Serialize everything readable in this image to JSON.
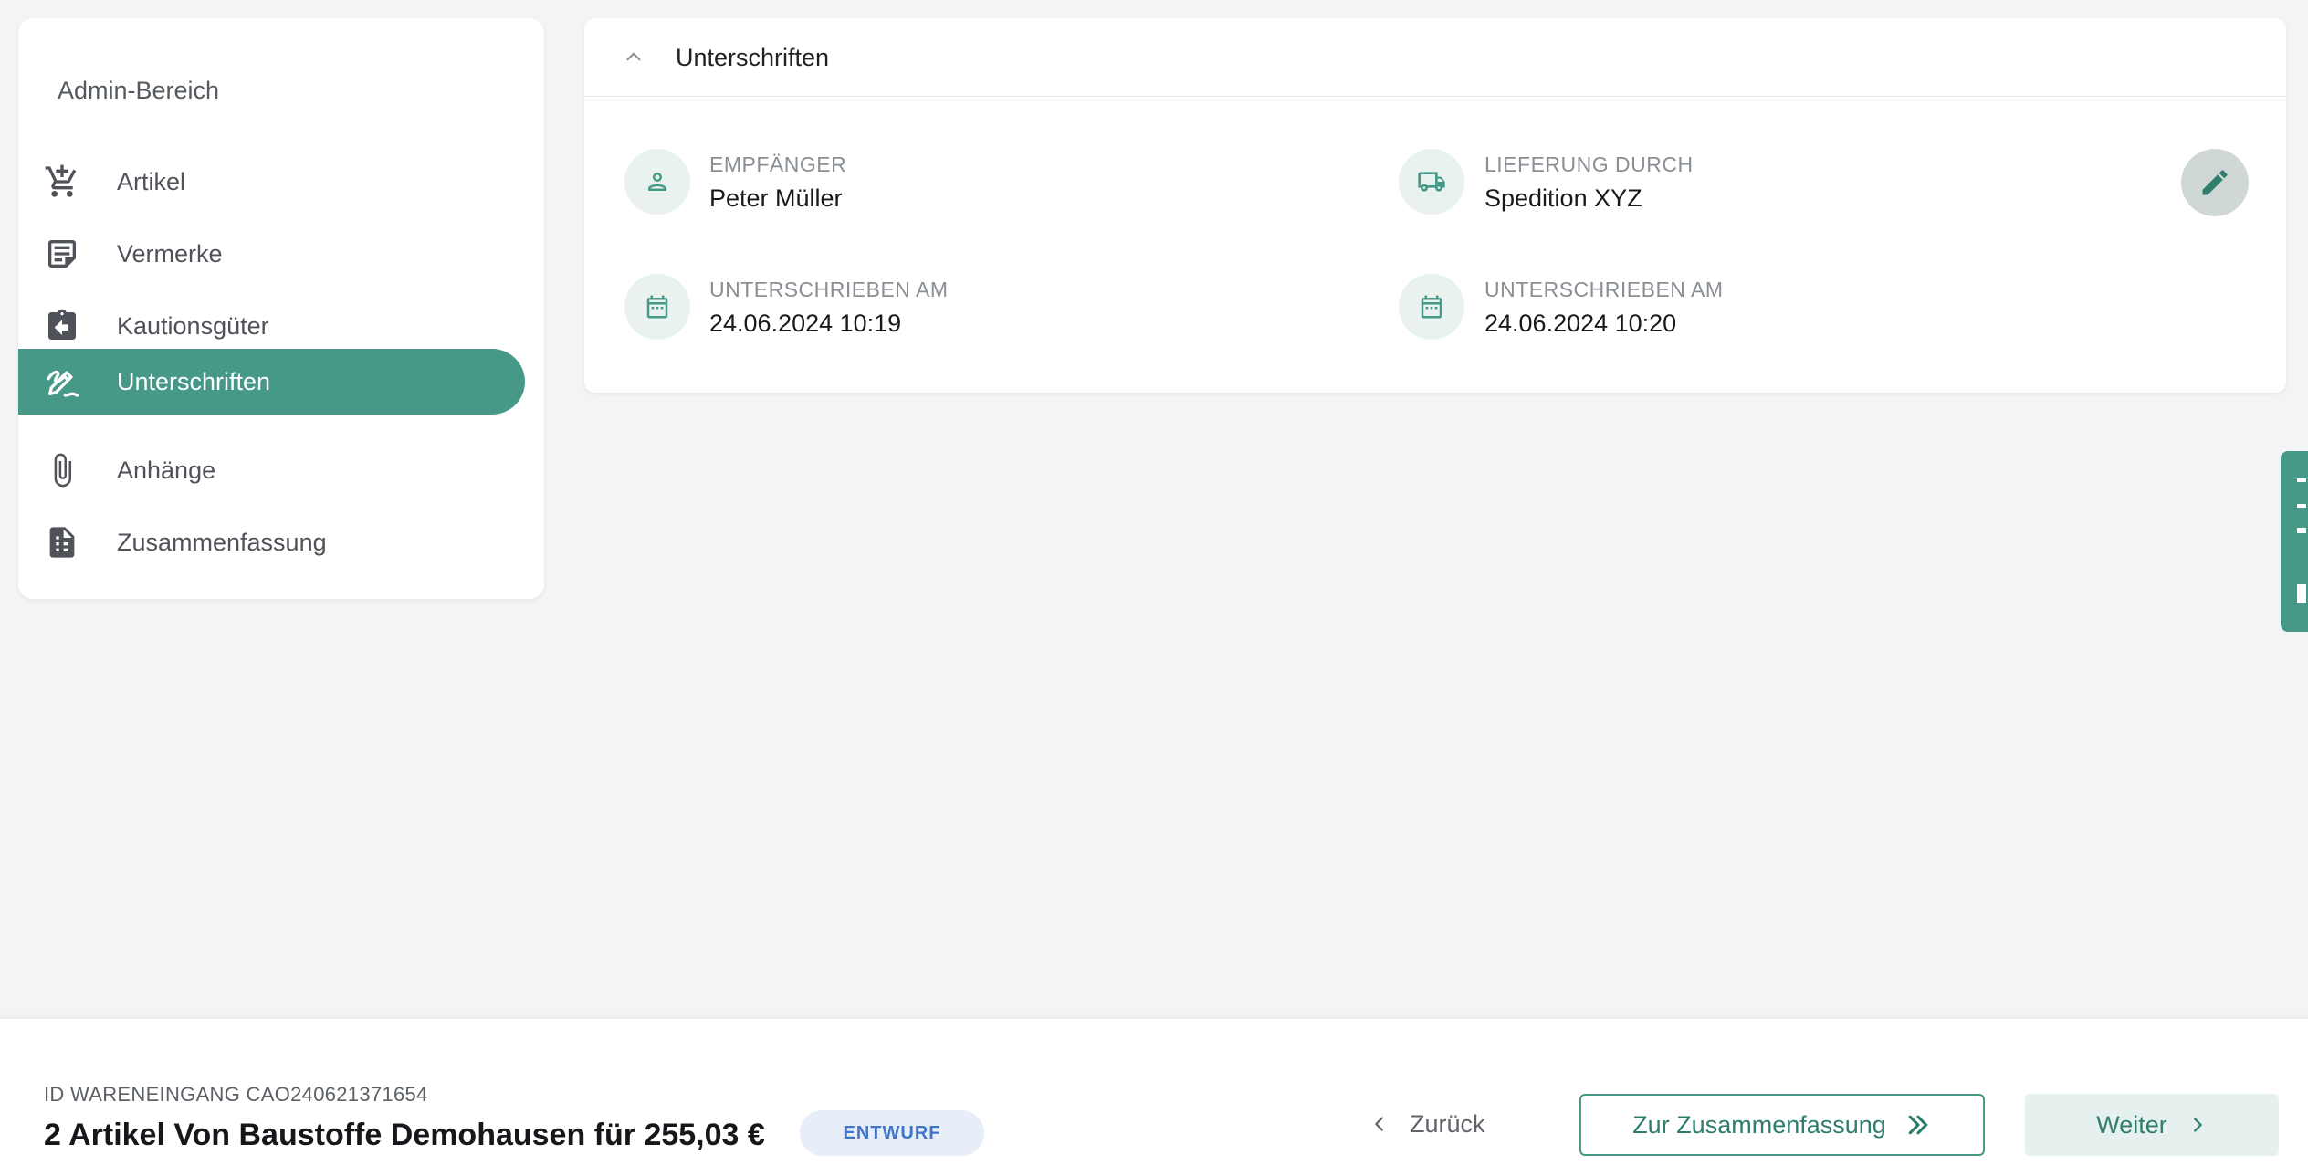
{
  "sidebar": {
    "header": "Admin-Bereich",
    "items": [
      {
        "label": "Artikel",
        "icon": "cart-add-icon",
        "active": false
      },
      {
        "label": "Vermerke",
        "icon": "note-icon",
        "active": false
      },
      {
        "label": "Kautionsgüter",
        "icon": "clipboard-return-icon",
        "active": false
      },
      {
        "label": "Unterschriften",
        "icon": "signature-icon",
        "active": true
      },
      {
        "label": "Anhänge",
        "icon": "paperclip-icon",
        "active": false
      },
      {
        "label": "Zusammenfassung",
        "icon": "summary-document-icon",
        "active": false
      }
    ]
  },
  "card": {
    "title": "Unterschriften",
    "fields": {
      "recipient": {
        "label": "EMPFÄNGER",
        "value": "Peter Müller",
        "icon": "person-icon"
      },
      "delivery": {
        "label": "LIEFERUNG DURCH",
        "value": "Spedition XYZ",
        "icon": "truck-icon"
      },
      "signed_recipient": {
        "label": "UNTERSCHRIEBEN AM",
        "value": "24.06.2024 10:19",
        "icon": "calendar-icon"
      },
      "signed_delivery": {
        "label": "UNTERSCHRIEBEN AM",
        "value": "24.06.2024 10:20",
        "icon": "calendar-icon"
      }
    }
  },
  "footer": {
    "receipt_id": "ID WARENEINGANG CAO240621371654",
    "summary": "2 Artikel Von Baustoffe Demohausen für 255,03 €",
    "status": "ENTWURF",
    "back_label": "Zurück",
    "summary_button_label": "Zur Zusammenfassung",
    "next_label": "Weiter"
  },
  "colors": {
    "accent": "#469987",
    "accent_light": "#eaf2f0",
    "background": "#f3f4f6",
    "badge_text": "#3f74c6",
    "badge_bg": "#e7eef8"
  }
}
